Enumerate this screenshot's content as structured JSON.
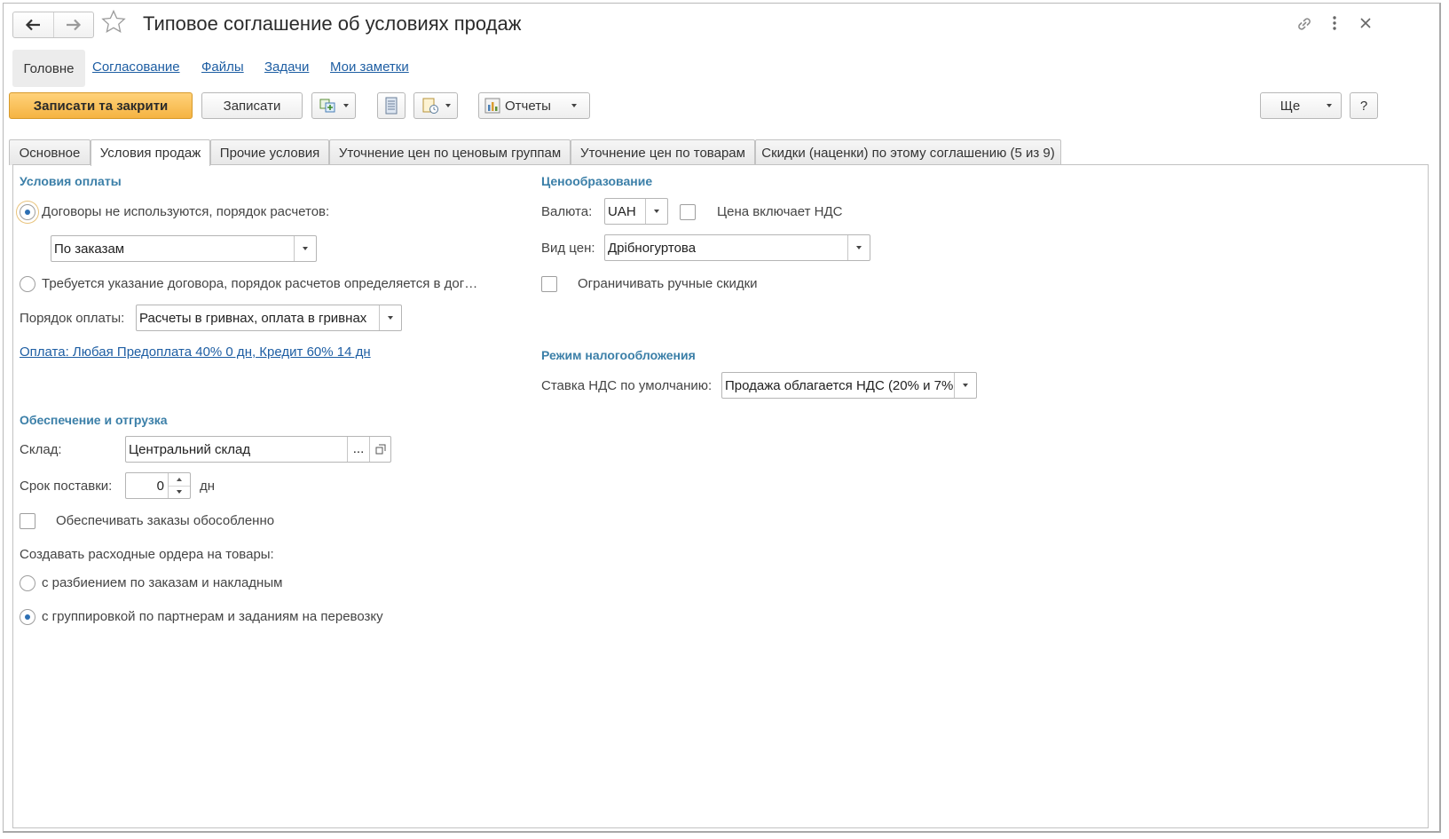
{
  "window": {
    "title": "Типовое соглашение об условиях продаж"
  },
  "sections": {
    "active": "Головне",
    "links": [
      "Согласование",
      "Файлы",
      "Задачи",
      "Мои заметки"
    ]
  },
  "toolbar": {
    "save_close": "Записати та закрити",
    "save": "Записати",
    "reports": "Отчеты",
    "more": "Ще",
    "help": "?"
  },
  "tabs": [
    {
      "label": "Основное",
      "active": false
    },
    {
      "label": "Условия продаж",
      "active": true
    },
    {
      "label": "Прочие условия",
      "active": false
    },
    {
      "label": "Уточнение цен по ценовым группам",
      "active": false
    },
    {
      "label": "Уточнение цен по товарам",
      "active": false
    },
    {
      "label": "Скидки (наценки) по этому соглашению (5 из 9)",
      "active": false
    }
  ],
  "payment": {
    "group_title": "Условия оплаты",
    "radio1_label": "Договоры не используются, порядок расчетов:",
    "radio1_selected": true,
    "settlement_value": "По заказам",
    "radio2_label": "Требуется указание договора, порядок расчетов определяется в дог…",
    "radio2_selected": false,
    "order_label": "Порядок оплаты:",
    "order_value": "Расчеты в гривнах, оплата в гривнах",
    "terms_link": "Оплата: Любая Предоплата 40% 0 дн, Кредит 60% 14 дн"
  },
  "supply": {
    "group_title": "Обеспечение и отгрузка",
    "warehouse_label": "Склад:",
    "warehouse_value": "Центральний склад",
    "warehouse_select": "...",
    "lead_time_label": "Срок поставки:",
    "lead_time_value": "0",
    "lead_time_unit": "дн",
    "separate_label": "Обеспечивать заказы обособленно",
    "separate_checked": false,
    "orders_label": "Создавать расходные ордера на товары:",
    "orders_option1": "с разбиением по заказам и накладным",
    "orders_option1_selected": false,
    "orders_option2": "с группировкой по партнерам и заданиям на перевозку",
    "orders_option2_selected": true
  },
  "pricing": {
    "group_title": "Ценообразование",
    "currency_label": "Валюта:",
    "currency_value": "UAH",
    "vat_included_label": "Цена включает НДС",
    "vat_included_checked": false,
    "price_type_label": "Вид цен:",
    "price_type_value": "Дрібногуртова",
    "limit_discounts_label": "Ограничивать ручные скидки",
    "limit_discounts_checked": false
  },
  "tax": {
    "group_title": "Режим налогообложения",
    "vat_rate_label": "Ставка НДС по умолчанию:",
    "vat_rate_value": "Продажа облагается НДС (20% и 7%"
  },
  "colors": {
    "primary_button": "#f5b342",
    "link": "#1e5ea3",
    "group_title": "#3b7fa8"
  }
}
